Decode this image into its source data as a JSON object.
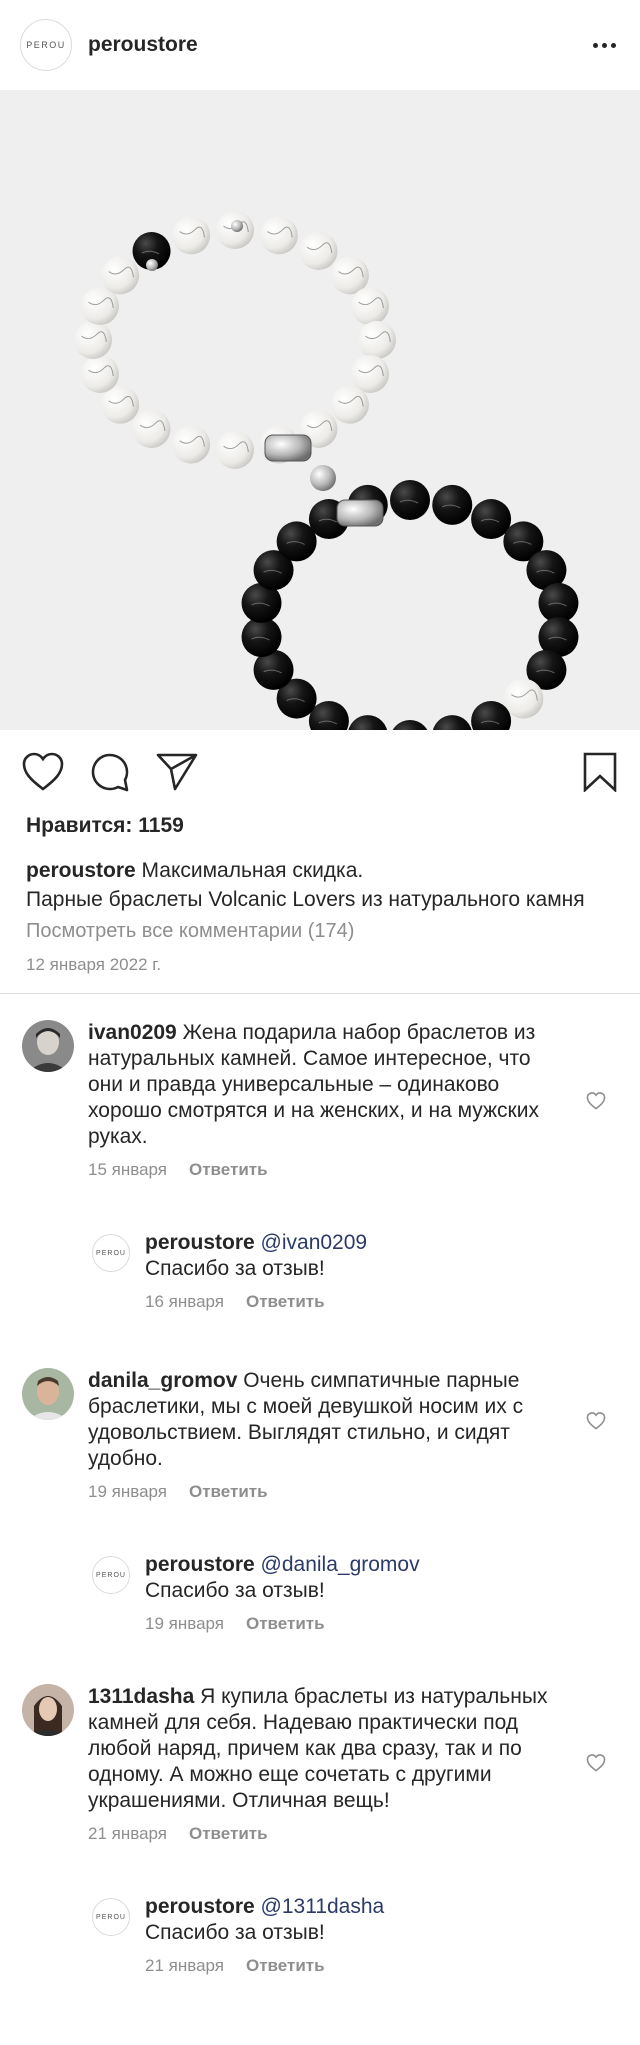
{
  "header": {
    "logo_text": "PEROU",
    "username": "peroustore",
    "more_icon": "more-horizontal-icon"
  },
  "post": {
    "likes": "Нравится: 1159",
    "caption_user": "peroustore",
    "caption_text": "Максимальная скидка.\nПарные браслеты Volcanic Lovers из натурального камня",
    "view_comments": "Посмотреть все комментарии (174)",
    "date": "12 января 2022 г."
  },
  "comments": [
    {
      "user": "ivan0209",
      "text": "Жена подарила набор браслетов из натуральных камней. Самое интересное, что они и правда универсальные – одинаково хорошо смотрятся и на женских, и на мужских руках.",
      "date": "15 января",
      "reply_label": "Ответить"
    },
    {
      "user": "peroustore",
      "mention": "@ivan0209",
      "text": "Спасибо за отзыв!",
      "date": "16 января",
      "reply_label": "Ответить"
    },
    {
      "user": "danila_gromov",
      "text": "Очень симпатичные парные браслетики, мы с моей девушкой носим их с удовольствием. Выглядят стильно, и сидят удобно.",
      "date": "19 января",
      "reply_label": "Ответить"
    },
    {
      "user": "peroustore",
      "mention": "@danila_gromov",
      "text": "Спасибо за отзыв!",
      "date": "19 января",
      "reply_label": "Ответить"
    },
    {
      "user": "1311dasha",
      "text": "Я купила браслеты из натуральных камней для себя. Надеваю практически под любой наряд, причем как два сразу, так и по одному. А можно еще сочетать с другими украшениями. Отличная вещь!",
      "date": "21 января",
      "reply_label": "Ответить"
    },
    {
      "user": "peroustore",
      "mention": "@1311dasha",
      "text": "Спасибо за отзыв!",
      "date": "21 января",
      "reply_label": "Ответить"
    }
  ],
  "colors": {
    "text": "#262626",
    "muted": "#8e8e8e",
    "mention": "#2b3a67",
    "photo_bg": "#efefef"
  }
}
